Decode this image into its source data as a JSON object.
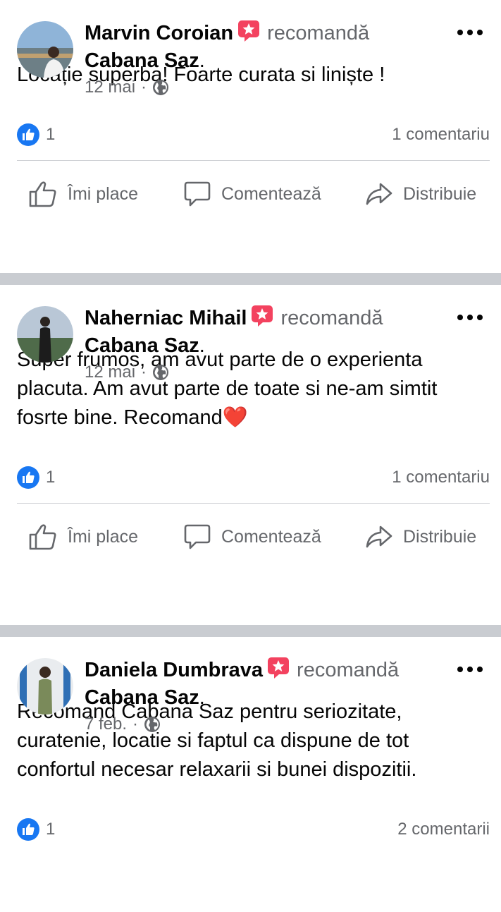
{
  "posts": [
    {
      "author": "Marvin Coroian",
      "verb": "recomandă",
      "page": "Cabana Saz",
      "date": "12 mai",
      "text": "Locație superba! Foarte curata si liniște !",
      "likes": "1",
      "comments": "1 comentariu"
    },
    {
      "author": "Naherniac Mihail",
      "verb": "recomandă",
      "page": "Cabana Saz",
      "date": "12 mai",
      "text": "Super frumos, am avut parte de o experienta placuta. Am avut parte de toate si ne-am simtit fosrte bine. Recomand❤️",
      "likes": "1",
      "comments": "1 comentariu"
    },
    {
      "author": "Daniela Dumbrava",
      "verb": "recomandă",
      "page": "Cabana Saz",
      "date": "7 feb.",
      "text": "Recomand Cabana Saz pentru seriozitate, curatenie, locatie si faptul ca dispune de tot confortul necesar relaxarii si bunei dispozitii.",
      "likes": "1",
      "comments": "2 comentarii"
    }
  ],
  "actions": {
    "like": "Îmi place",
    "comment": "Comentează",
    "share": "Distribuie"
  },
  "punctuation": {
    "period": ".",
    "dot": "·"
  },
  "colors": {
    "accent": "#1877f2",
    "recommend": "#f3425f",
    "secondary": "#65676b",
    "separator": "#c9ccd1"
  }
}
